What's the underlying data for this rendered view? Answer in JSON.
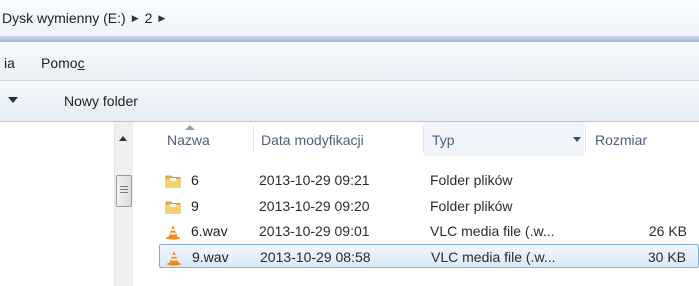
{
  "address": {
    "crumbs": [
      "Dysk wymienny (E:)",
      "2"
    ]
  },
  "menu": {
    "items": [
      "ia",
      "Pomoc"
    ]
  },
  "toolbar": {
    "new_folder": "Nowy folder"
  },
  "columns": {
    "name": "Nazwa",
    "date": "Data modyfikacji",
    "type": "Typ",
    "size": "Rozmiar"
  },
  "files": [
    {
      "name": "6",
      "date": "2013-10-29 09:21",
      "type": "Folder plików",
      "size": "",
      "icon": "folder-icon"
    },
    {
      "name": "9",
      "date": "2013-10-29 09:20",
      "type": "Folder plików",
      "size": "",
      "icon": "folder-icon"
    },
    {
      "name": "6.wav",
      "date": "2013-10-29 09:01",
      "type": "VLC media file (.w...",
      "size": "26 KB",
      "icon": "vlc-icon"
    },
    {
      "name": "9.wav",
      "date": "2013-10-29 08:58",
      "type": "VLC media file (.w...",
      "size": "30 KB",
      "icon": "vlc-icon",
      "selected": true
    }
  ],
  "colors": {
    "accent": "#84acdd",
    "header_text": "#4c607a",
    "folder": "#e8b64a",
    "vlc": "#f08a1c"
  }
}
